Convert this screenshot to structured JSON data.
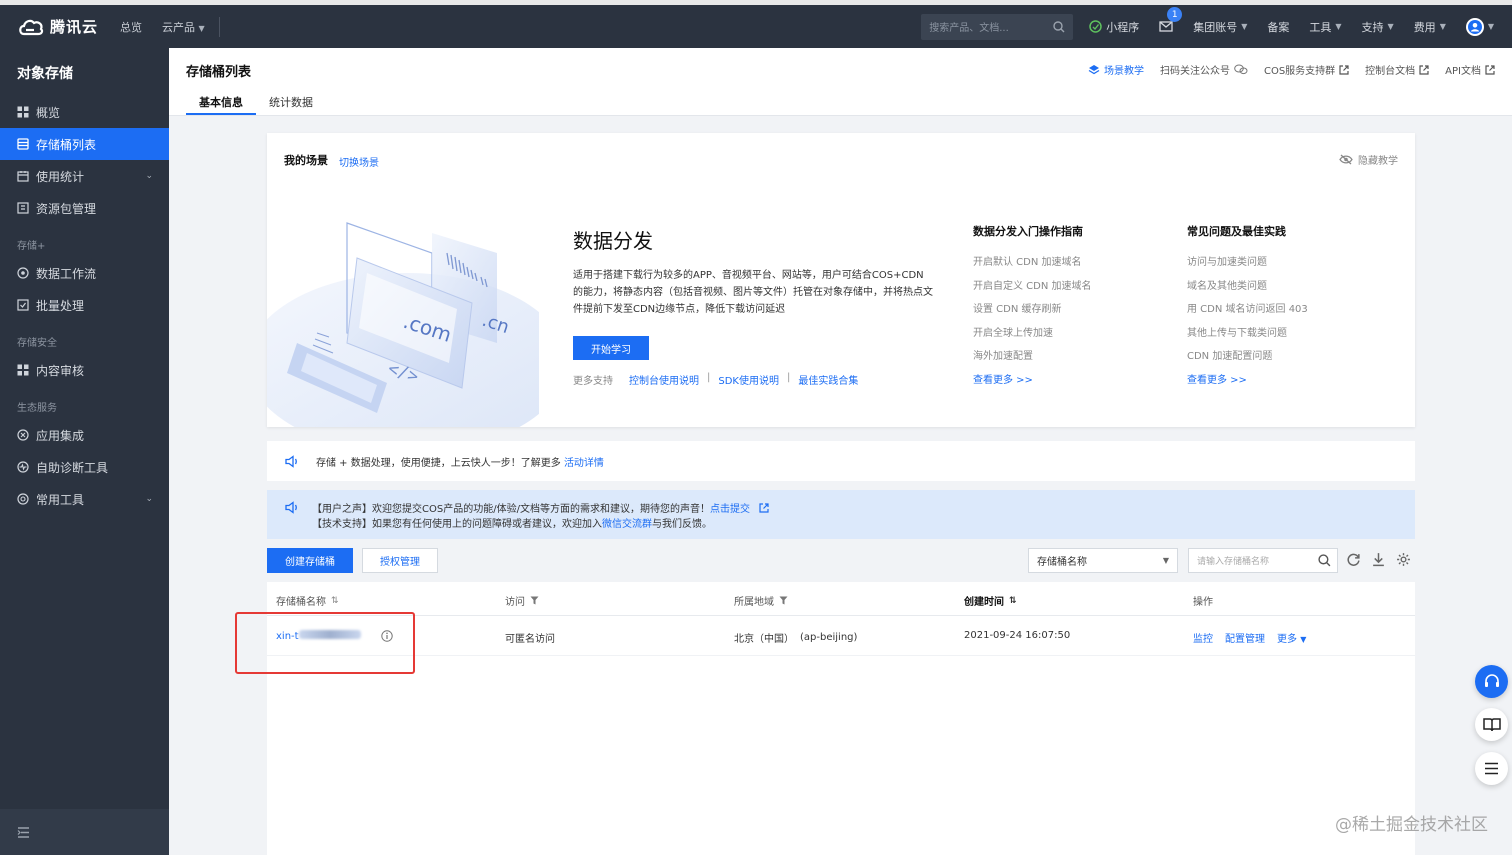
{
  "colors": {
    "brand": "#1c6df3",
    "nav_bg": "#2b3340",
    "notice_bg": "#dce9fb",
    "highlight": "#e53935"
  },
  "topbar": {
    "logo_text": "腾讯云",
    "nav": [
      "总览",
      "云产品"
    ],
    "search_placeholder": "搜索产品、文档...",
    "mini_program": "小程序",
    "mail_badge": "1",
    "group_account": "集团账号",
    "beian": "备案",
    "tools": "工具",
    "support": "支持",
    "fees": "费用"
  },
  "sidebar": {
    "title": "对象存储",
    "items": [
      "概览",
      "存储桶列表",
      "使用统计",
      "资源包管理"
    ],
    "group_storage_plus": "存储+",
    "storage_plus_items": [
      "数据工作流",
      "批量处理"
    ],
    "group_security": "存储安全",
    "security_items": [
      "内容审核"
    ],
    "group_ecosystem": "生态服务",
    "ecosystem_items": [
      "应用集成",
      "自助诊断工具",
      "常用工具"
    ]
  },
  "header": {
    "title": "存储桶列表",
    "tabs": [
      "基本信息",
      "统计数据"
    ],
    "links": [
      "场景教学",
      "扫码关注公众号",
      "COS服务支持群",
      "控制台文档",
      "API文档"
    ]
  },
  "scene": {
    "title": "我的场景",
    "switch": "切换场景",
    "hide": "隐藏教学",
    "heading": "数据分发",
    "desc": "适用于搭建下载行为较多的APP、音视频平台、网站等，用户可结合COS+CDN的能力，将静态内容（包括音视频、图片等文件）托管在对象存储中，并将热点文件提前下发至CDN边缘节点，降低下载访问延迟",
    "start_button": "开始学习",
    "support_label": "更多支持",
    "support_links": [
      "控制台使用说明",
      "SDK使用说明",
      "最佳实践合集"
    ],
    "guide1": {
      "title": "数据分发入门操作指南",
      "items": [
        "开启默认 CDN 加速域名",
        "开启自定义 CDN 加速域名",
        "设置 CDN 缓存刷新",
        "开启全球上传加速",
        "海外加速配置"
      ],
      "more": "查看更多 >>"
    },
    "guide2": {
      "title": "常见问题及最佳实践",
      "items": [
        "访问与加速类问题",
        "域名及其他类问题",
        "用 CDN 域名访问返回 403",
        "其他上传与下载类问题",
        "CDN 加速配置问题"
      ],
      "more": "查看更多 >>"
    },
    "illus_text": [
      ".com",
      ".cn",
      "</>"
    ]
  },
  "notice1": {
    "text": "存储 + 数据处理，使用便捷，上云快人一步！了解更多",
    "link": "活动详情"
  },
  "notice2": {
    "line1": "【用户之声】欢迎您提交COS产品的功能/体验/文档等方面的需求和建议，期待您的声音！",
    "line1_link": "点击提交",
    "line2_pre": "【技术支持】如果您有任何使用上的问题障碍或者建议，欢迎加入",
    "line2_link": "微信交流群",
    "line2_post": "与我们反馈。"
  },
  "toolbar": {
    "create": "创建存储桶",
    "auth": "授权管理",
    "select_value": "存储桶名称",
    "search_placeholder": "请输入存储桶名称"
  },
  "table": {
    "headers": [
      "存储桶名称",
      "访问",
      "所属地域",
      "创建时间",
      "操作"
    ],
    "row": {
      "name_prefix": "xin-t",
      "access": "可匿名访问",
      "region": "北京（中国）",
      "region_code": "(ap-beijing)",
      "created": "2021-09-24 16:07:50",
      "actions": [
        "监控",
        "配置管理",
        "更多"
      ]
    }
  },
  "watermark": "@稀土掘金技术社区"
}
